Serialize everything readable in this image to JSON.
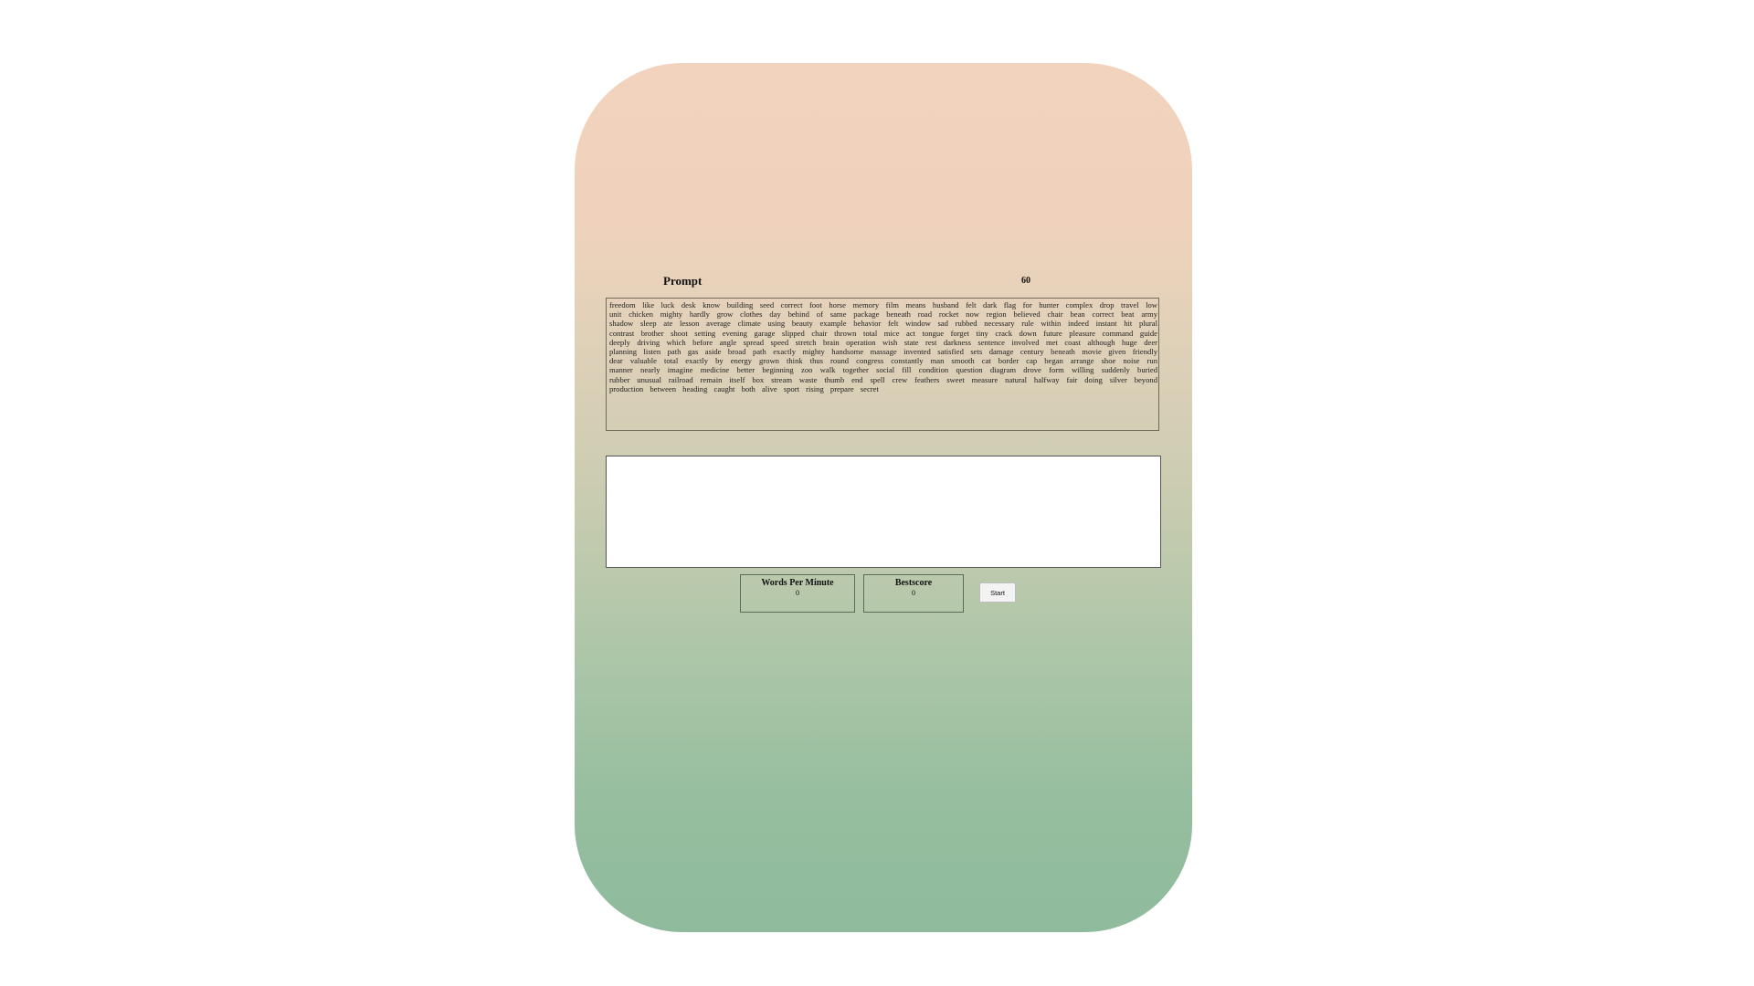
{
  "prompt": {
    "title": "Prompt",
    "timer": "60",
    "text": "freedom like luck desk know building seed correct foot horse memory film means husband felt dark flag for hunter complex drop travel low unit chicken mighty hardly grow clothes day behind of same package beneath road rocket now region believed chair bean correct beat army shadow sleep ate lesson average climate using beauty example behavior felt window sad rubbed necessary rule within indeed instant hit plural contrast brother shoot setting evening garage slipped chair thrown total mice act tongue forget tiny crack down future pleasure command guide deeply driving which before angle spread speed stretch brain operation wish state rest darkness sentence involved met coast although huge deer planning listen path gas aside broad path exactly mighty handsome massage invented satisfied sets damage century beneath movie given friendly dear valuable total exactly by energy grown think thus round congress constantly man smooth cat border cap began arrange shoe noise run manner nearly imagine medicine better beginning zoo walk together social fill condition question diagram drove form willing suddenly buried rubber unusual railroad remain itself box stream waste thumb end spell crew feathers sweet measure natural halfway fair doing silver beyond production between heading caught both alive sport rising prepare secret"
  },
  "typing": {
    "value": ""
  },
  "stats": {
    "wpm_label": "Words Per Minute",
    "wpm_value": "0",
    "best_label": "Bestscore",
    "best_value": "0"
  },
  "controls": {
    "start_label": "Start"
  },
  "colors": {
    "gradient_top": "#f2d3bd",
    "gradient_bottom": "#8fbb9d",
    "box_border": "#6c6c58"
  }
}
